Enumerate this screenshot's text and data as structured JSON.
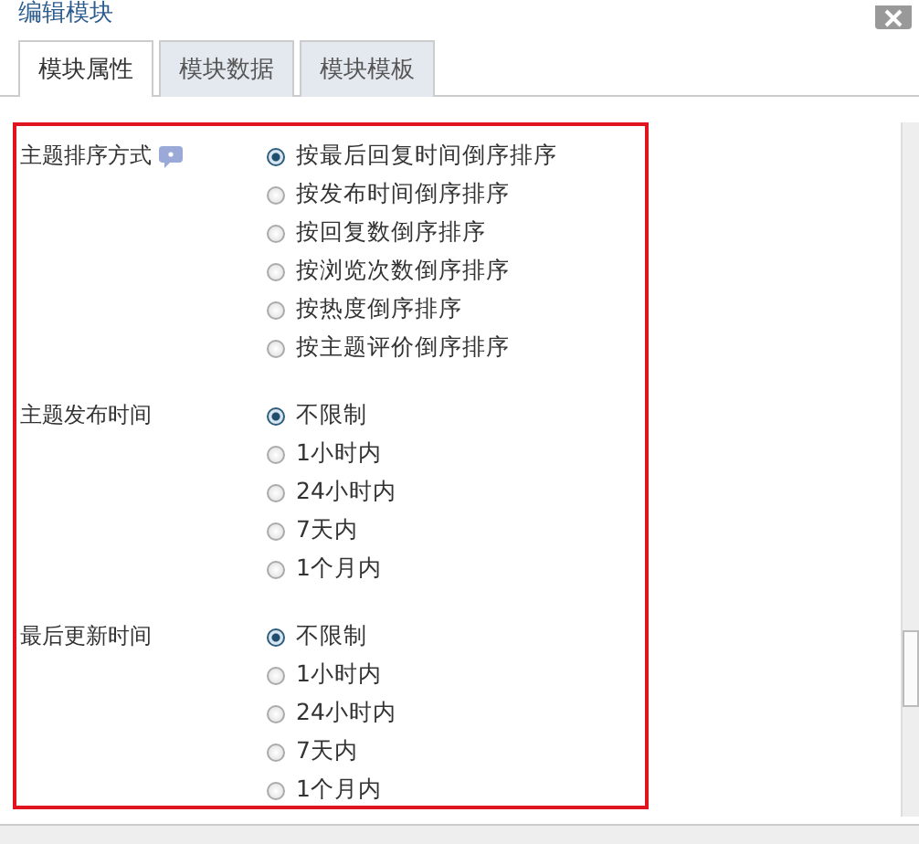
{
  "window": {
    "title": "编辑模块"
  },
  "tabs": [
    {
      "label": "模块属性",
      "selected": true
    },
    {
      "label": "模块数据",
      "selected": false
    },
    {
      "label": "模块模板",
      "selected": false
    }
  ],
  "groups": [
    {
      "label": "主题排序方式",
      "help": true,
      "options": [
        {
          "label": "按最后回复时间倒序排序",
          "selected": true
        },
        {
          "label": "按发布时间倒序排序",
          "selected": false
        },
        {
          "label": "按回复数倒序排序",
          "selected": false
        },
        {
          "label": "按浏览次数倒序排序",
          "selected": false
        },
        {
          "label": "按热度倒序排序",
          "selected": false
        },
        {
          "label": "按主题评价倒序排序",
          "selected": false
        }
      ]
    },
    {
      "label": "主题发布时间",
      "help": false,
      "options": [
        {
          "label": "不限制",
          "selected": true
        },
        {
          "label": "1小时内",
          "selected": false
        },
        {
          "label": "24小时内",
          "selected": false
        },
        {
          "label": "7天内",
          "selected": false
        },
        {
          "label": "1个月内",
          "selected": false
        }
      ]
    },
    {
      "label": "最后更新时间",
      "help": false,
      "options": [
        {
          "label": "不限制",
          "selected": true
        },
        {
          "label": "1小时内",
          "selected": false
        },
        {
          "label": "24小时内",
          "selected": false
        },
        {
          "label": "7天内",
          "selected": false
        },
        {
          "label": "1个月内",
          "selected": false
        }
      ]
    }
  ]
}
